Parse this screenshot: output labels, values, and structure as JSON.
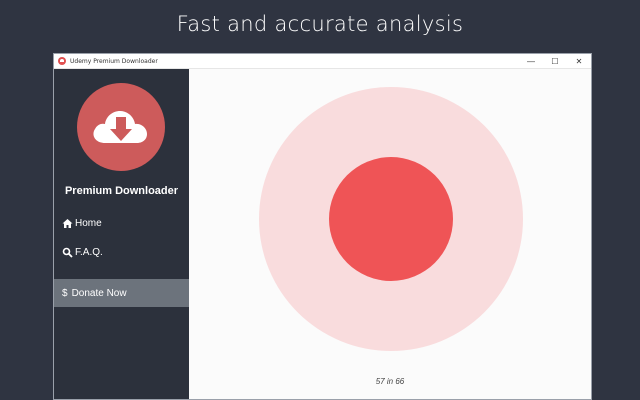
{
  "headline": "Fast and accurate analysis",
  "window": {
    "title": "Udemy Premium Downloader",
    "controls": {
      "minimize": "—",
      "maximize": "☐",
      "close": "✕"
    }
  },
  "sidebar": {
    "app_name": "Premium Downloader",
    "items": [
      {
        "label": "Home",
        "icon": "home-icon"
      },
      {
        "label": "F.A.Q.",
        "icon": "search-icon"
      },
      {
        "label": "Donate Now",
        "icon": "dollar-icon",
        "icon_glyph": "$",
        "active": true
      }
    ]
  },
  "main": {
    "progress": {
      "current": 57,
      "total": 66,
      "text": "57 in 66"
    }
  },
  "colors": {
    "background": "#2f3441",
    "sidebar": "#2c313c",
    "sidebar_active": "#6c737c",
    "logo": "#cd5b5b",
    "accent": "#ef5456",
    "accent_light": "#f9dcdd"
  }
}
